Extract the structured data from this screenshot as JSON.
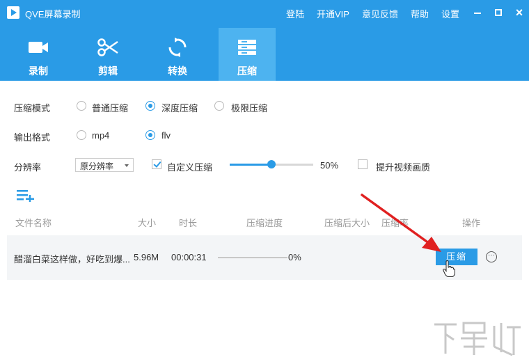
{
  "app": {
    "title": "QVE屏幕录制",
    "top_links": [
      "登陆",
      "开通VIP",
      "意见反馈",
      "帮助",
      "设置"
    ],
    "window_controls": {
      "close": "×"
    }
  },
  "tabs": [
    {
      "label": "录制",
      "icon": "video-camera-icon"
    },
    {
      "label": "剪辑",
      "icon": "scissors-icon"
    },
    {
      "label": "转换",
      "icon": "convert-icon"
    },
    {
      "label": "压缩",
      "icon": "compress-icon",
      "active": true
    }
  ],
  "settings": {
    "mode": {
      "label": "压缩模式",
      "options": [
        "普通压缩",
        "深度压缩",
        "极限压缩"
      ],
      "selected": "深度压缩"
    },
    "format": {
      "label": "输出格式",
      "options": [
        "mp4",
        "flv"
      ],
      "selected": "flv"
    },
    "resolution": {
      "label": "分辨率",
      "select_value": "原分辨率",
      "custom_label": "自定义压缩",
      "custom_checked": true,
      "slider_value": 0.5,
      "slider_text": "50%",
      "enhance_label": "提升视频画质",
      "enhance_checked": false
    }
  },
  "table": {
    "columns": [
      "文件名称",
      "大小",
      "时长",
      "压缩进度",
      "压缩后大小",
      "压缩率",
      "操作"
    ],
    "rows": [
      {
        "name": "醋溜白菜这样做，好吃到爆...",
        "size": "5.96M",
        "duration": "00:00:31",
        "progress": "0%",
        "progress_value": 0,
        "action": "压缩"
      }
    ]
  },
  "colors": {
    "primary": "#2a9be6",
    "active_tab": "#4db3f0",
    "annotation_arrow": "#e02020"
  }
}
